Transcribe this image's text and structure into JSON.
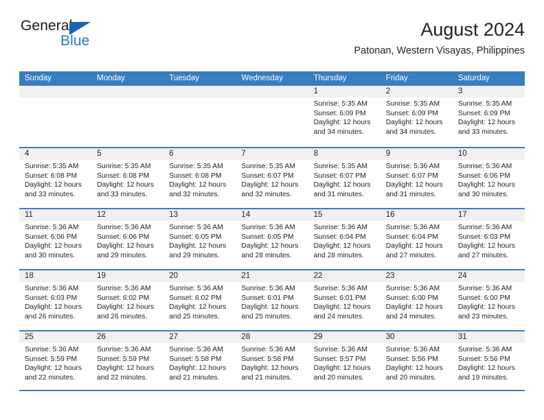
{
  "brand": {
    "name_part1": "General",
    "name_part2": "Blue",
    "triangle_color": "#1565b0",
    "blue_color": "#1f77c4"
  },
  "header": {
    "title": "August 2024",
    "subtitle": "Patonan, Western Visayas, Philippines"
  },
  "theme": {
    "header_band": "#3a7dbf",
    "day_number_band": "#f0f0f0",
    "text": "#222222"
  },
  "weekdays": [
    "Sunday",
    "Monday",
    "Tuesday",
    "Wednesday",
    "Thursday",
    "Friday",
    "Saturday"
  ],
  "weeks": [
    [
      {
        "day": "",
        "sunrise": "",
        "sunset": "",
        "daylight1": "",
        "daylight2": ""
      },
      {
        "day": "",
        "sunrise": "",
        "sunset": "",
        "daylight1": "",
        "daylight2": ""
      },
      {
        "day": "",
        "sunrise": "",
        "sunset": "",
        "daylight1": "",
        "daylight2": ""
      },
      {
        "day": "",
        "sunrise": "",
        "sunset": "",
        "daylight1": "",
        "daylight2": ""
      },
      {
        "day": "1",
        "sunrise": "Sunrise: 5:35 AM",
        "sunset": "Sunset: 6:09 PM",
        "daylight1": "Daylight: 12 hours",
        "daylight2": "and 34 minutes."
      },
      {
        "day": "2",
        "sunrise": "Sunrise: 5:35 AM",
        "sunset": "Sunset: 6:09 PM",
        "daylight1": "Daylight: 12 hours",
        "daylight2": "and 34 minutes."
      },
      {
        "day": "3",
        "sunrise": "Sunrise: 5:35 AM",
        "sunset": "Sunset: 6:09 PM",
        "daylight1": "Daylight: 12 hours",
        "daylight2": "and 33 minutes."
      }
    ],
    [
      {
        "day": "4",
        "sunrise": "Sunrise: 5:35 AM",
        "sunset": "Sunset: 6:08 PM",
        "daylight1": "Daylight: 12 hours",
        "daylight2": "and 33 minutes."
      },
      {
        "day": "5",
        "sunrise": "Sunrise: 5:35 AM",
        "sunset": "Sunset: 6:08 PM",
        "daylight1": "Daylight: 12 hours",
        "daylight2": "and 33 minutes."
      },
      {
        "day": "6",
        "sunrise": "Sunrise: 5:35 AM",
        "sunset": "Sunset: 6:08 PM",
        "daylight1": "Daylight: 12 hours",
        "daylight2": "and 32 minutes."
      },
      {
        "day": "7",
        "sunrise": "Sunrise: 5:35 AM",
        "sunset": "Sunset: 6:07 PM",
        "daylight1": "Daylight: 12 hours",
        "daylight2": "and 32 minutes."
      },
      {
        "day": "8",
        "sunrise": "Sunrise: 5:35 AM",
        "sunset": "Sunset: 6:07 PM",
        "daylight1": "Daylight: 12 hours",
        "daylight2": "and 31 minutes."
      },
      {
        "day": "9",
        "sunrise": "Sunrise: 5:36 AM",
        "sunset": "Sunset: 6:07 PM",
        "daylight1": "Daylight: 12 hours",
        "daylight2": "and 31 minutes."
      },
      {
        "day": "10",
        "sunrise": "Sunrise: 5:36 AM",
        "sunset": "Sunset: 6:06 PM",
        "daylight1": "Daylight: 12 hours",
        "daylight2": "and 30 minutes."
      }
    ],
    [
      {
        "day": "11",
        "sunrise": "Sunrise: 5:36 AM",
        "sunset": "Sunset: 6:06 PM",
        "daylight1": "Daylight: 12 hours",
        "daylight2": "and 30 minutes."
      },
      {
        "day": "12",
        "sunrise": "Sunrise: 5:36 AM",
        "sunset": "Sunset: 6:06 PM",
        "daylight1": "Daylight: 12 hours",
        "daylight2": "and 29 minutes."
      },
      {
        "day": "13",
        "sunrise": "Sunrise: 5:36 AM",
        "sunset": "Sunset: 6:05 PM",
        "daylight1": "Daylight: 12 hours",
        "daylight2": "and 29 minutes."
      },
      {
        "day": "14",
        "sunrise": "Sunrise: 5:36 AM",
        "sunset": "Sunset: 6:05 PM",
        "daylight1": "Daylight: 12 hours",
        "daylight2": "and 28 minutes."
      },
      {
        "day": "15",
        "sunrise": "Sunrise: 5:36 AM",
        "sunset": "Sunset: 6:04 PM",
        "daylight1": "Daylight: 12 hours",
        "daylight2": "and 28 minutes."
      },
      {
        "day": "16",
        "sunrise": "Sunrise: 5:36 AM",
        "sunset": "Sunset: 6:04 PM",
        "daylight1": "Daylight: 12 hours",
        "daylight2": "and 27 minutes."
      },
      {
        "day": "17",
        "sunrise": "Sunrise: 5:36 AM",
        "sunset": "Sunset: 6:03 PM",
        "daylight1": "Daylight: 12 hours",
        "daylight2": "and 27 minutes."
      }
    ],
    [
      {
        "day": "18",
        "sunrise": "Sunrise: 5:36 AM",
        "sunset": "Sunset: 6:03 PM",
        "daylight1": "Daylight: 12 hours",
        "daylight2": "and 26 minutes."
      },
      {
        "day": "19",
        "sunrise": "Sunrise: 5:36 AM",
        "sunset": "Sunset: 6:02 PM",
        "daylight1": "Daylight: 12 hours",
        "daylight2": "and 26 minutes."
      },
      {
        "day": "20",
        "sunrise": "Sunrise: 5:36 AM",
        "sunset": "Sunset: 6:02 PM",
        "daylight1": "Daylight: 12 hours",
        "daylight2": "and 25 minutes."
      },
      {
        "day": "21",
        "sunrise": "Sunrise: 5:36 AM",
        "sunset": "Sunset: 6:01 PM",
        "daylight1": "Daylight: 12 hours",
        "daylight2": "and 25 minutes."
      },
      {
        "day": "22",
        "sunrise": "Sunrise: 5:36 AM",
        "sunset": "Sunset: 6:01 PM",
        "daylight1": "Daylight: 12 hours",
        "daylight2": "and 24 minutes."
      },
      {
        "day": "23",
        "sunrise": "Sunrise: 5:36 AM",
        "sunset": "Sunset: 6:00 PM",
        "daylight1": "Daylight: 12 hours",
        "daylight2": "and 24 minutes."
      },
      {
        "day": "24",
        "sunrise": "Sunrise: 5:36 AM",
        "sunset": "Sunset: 6:00 PM",
        "daylight1": "Daylight: 12 hours",
        "daylight2": "and 23 minutes."
      }
    ],
    [
      {
        "day": "25",
        "sunrise": "Sunrise: 5:36 AM",
        "sunset": "Sunset: 5:59 PM",
        "daylight1": "Daylight: 12 hours",
        "daylight2": "and 22 minutes."
      },
      {
        "day": "26",
        "sunrise": "Sunrise: 5:36 AM",
        "sunset": "Sunset: 5:59 PM",
        "daylight1": "Daylight: 12 hours",
        "daylight2": "and 22 minutes."
      },
      {
        "day": "27",
        "sunrise": "Sunrise: 5:36 AM",
        "sunset": "Sunset: 5:58 PM",
        "daylight1": "Daylight: 12 hours",
        "daylight2": "and 21 minutes."
      },
      {
        "day": "28",
        "sunrise": "Sunrise: 5:36 AM",
        "sunset": "Sunset: 5:58 PM",
        "daylight1": "Daylight: 12 hours",
        "daylight2": "and 21 minutes."
      },
      {
        "day": "29",
        "sunrise": "Sunrise: 5:36 AM",
        "sunset": "Sunset: 5:57 PM",
        "daylight1": "Daylight: 12 hours",
        "daylight2": "and 20 minutes."
      },
      {
        "day": "30",
        "sunrise": "Sunrise: 5:36 AM",
        "sunset": "Sunset: 5:56 PM",
        "daylight1": "Daylight: 12 hours",
        "daylight2": "and 20 minutes."
      },
      {
        "day": "31",
        "sunrise": "Sunrise: 5:36 AM",
        "sunset": "Sunset: 5:56 PM",
        "daylight1": "Daylight: 12 hours",
        "daylight2": "and 19 minutes."
      }
    ]
  ]
}
